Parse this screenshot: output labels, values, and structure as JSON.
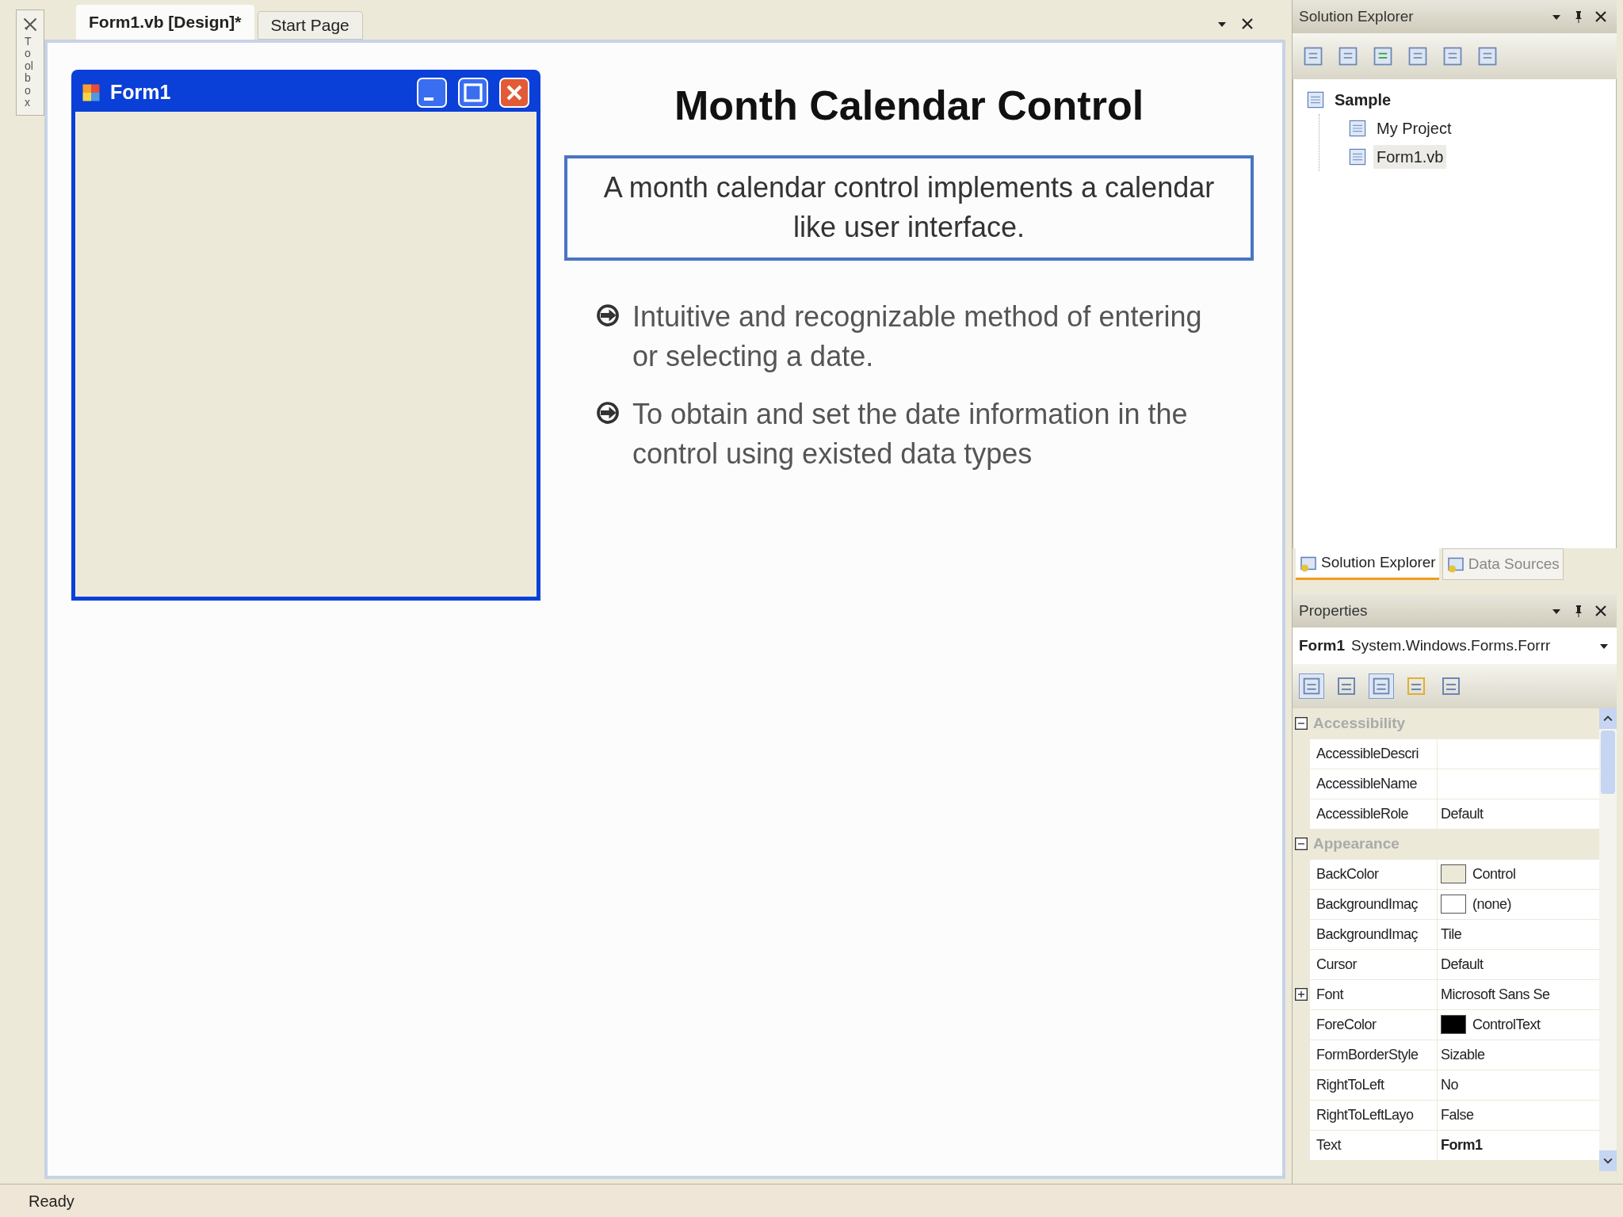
{
  "toolbox": {
    "label": "Toolbox"
  },
  "editor": {
    "tabs": [
      {
        "label": "Form1.vb [Design]*",
        "selected": true
      },
      {
        "label": "Start Page",
        "selected": false
      }
    ]
  },
  "form": {
    "title": "Form1"
  },
  "slide": {
    "title": "Month Calendar Control",
    "definition": "A month calendar control implements a calendar like user interface.",
    "bullets": [
      "Intuitive and recognizable method of entering or selecting a date.",
      "To obtain and set the date information in the control using existed data types"
    ]
  },
  "solution_explorer": {
    "title": "Solution Explorer",
    "tree": [
      {
        "label": "Sample",
        "selected": false,
        "children": [
          {
            "label": "My Project",
            "selected": false
          },
          {
            "label": "Form1.vb",
            "selected": true
          }
        ]
      }
    ],
    "tabs": [
      {
        "label": "Solution Explorer",
        "selected": true
      },
      {
        "label": "Data Sources",
        "selected": false
      }
    ]
  },
  "properties": {
    "title": "Properties",
    "object": "Form1",
    "type": "System.Windows.Forms.Forrr",
    "categories": [
      {
        "name": "Accessibility",
        "expanded": true,
        "rows": [
          {
            "kind": "plain",
            "name": "AccessibleDescri"
          },
          {
            "kind": "plain",
            "name": "AccessibleName"
          },
          {
            "kind": "plain",
            "name": "AccessibleRole",
            "value": "Default",
            "modified": false
          }
        ]
      },
      {
        "name": "Appearance",
        "expanded": true,
        "rows": [
          {
            "kind": "color",
            "name": "BackColor",
            "value": "Control",
            "color": "#ece9d8",
            "modified": false
          },
          {
            "kind": "color",
            "name": "BackgroundImaç",
            "value": "(none)",
            "color": "#ffffff",
            "modified": false
          },
          {
            "kind": "plain",
            "name": "BackgroundImaç",
            "value": "Tile",
            "modified": false
          },
          {
            "kind": "plain",
            "name": "Cursor",
            "value": "Default",
            "modified": false
          },
          {
            "kind": "group",
            "name": "Font",
            "value": "Microsoft Sans Se",
            "expanded": false,
            "modified": false
          },
          {
            "kind": "color",
            "name": "ForeColor",
            "value": "ControlText",
            "color": "#000000",
            "modified": false
          },
          {
            "kind": "plain",
            "name": "FormBorderStyle",
            "value": "Sizable",
            "modified": false
          },
          {
            "kind": "plain",
            "name": "RightToLeft",
            "value": "No",
            "modified": false
          },
          {
            "kind": "plain",
            "name": "RightToLeftLayo",
            "value": "False",
            "modified": false
          },
          {
            "kind": "plain",
            "name": "Text",
            "value": "Form1",
            "modified": true
          }
        ]
      }
    ]
  },
  "status_bar": {
    "text": "Ready"
  }
}
